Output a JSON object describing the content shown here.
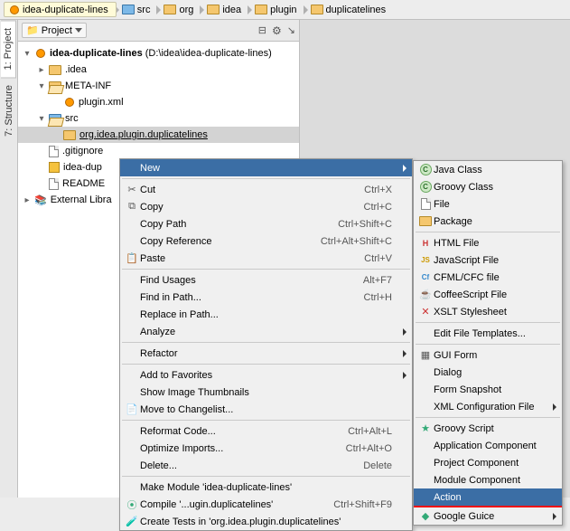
{
  "breadcrumb": [
    "idea-duplicate-lines",
    "src",
    "org",
    "idea",
    "plugin",
    "duplicatelines"
  ],
  "pane": {
    "title": "Project"
  },
  "left_rail": {
    "project": "1: Project",
    "structure": "7: Structure"
  },
  "tree": {
    "root": "idea-duplicate-lines",
    "root_hint": "(D:\\idea\\idea-duplicate-lines)",
    "idea": ".idea",
    "meta": "META-INF",
    "plugin_xml": "plugin.xml",
    "src": "src",
    "pkg": "org.idea.plugin.duplicatelines",
    "gitignore": ".gitignore",
    "iml": "idea-dup",
    "readme": "README",
    "ext": "External Libra"
  },
  "menu1": {
    "new": "New",
    "cut": "Cut",
    "cut_sc": "Ctrl+X",
    "copy": "Copy",
    "copy_sc": "Ctrl+C",
    "copy_path": "Copy Path",
    "copy_path_sc": "Ctrl+Shift+C",
    "copy_ref": "Copy Reference",
    "copy_ref_sc": "Ctrl+Alt+Shift+C",
    "paste": "Paste",
    "paste_sc": "Ctrl+V",
    "find_usages": "Find Usages",
    "find_usages_sc": "Alt+F7",
    "find_in_path": "Find in Path...",
    "find_in_path_sc": "Ctrl+H",
    "replace_in_path": "Replace in Path...",
    "analyze": "Analyze",
    "refactor": "Refactor",
    "add_fav": "Add to Favorites",
    "show_thumbs": "Show Image Thumbnails",
    "move_changelist": "Move to Changelist...",
    "reformat": "Reformat Code...",
    "reformat_sc": "Ctrl+Alt+L",
    "optimize": "Optimize Imports...",
    "optimize_sc": "Ctrl+Alt+O",
    "delete": "Delete...",
    "delete_sc": "Delete",
    "make_module": "Make Module 'idea-duplicate-lines'",
    "compile": "Compile '...ugin.duplicatelines'",
    "compile_sc": "Ctrl+Shift+F9",
    "create_tests": "Create Tests in 'org.idea.plugin.duplicatelines'"
  },
  "menu2": {
    "java_class": "Java Class",
    "groovy_class": "Groovy Class",
    "file": "File",
    "package": "Package",
    "html": "HTML File",
    "js": "JavaScript File",
    "cfml": "CFML/CFC file",
    "coffee": "CoffeeScript File",
    "xslt": "XSLT Stylesheet",
    "edit_tpl": "Edit File Templates...",
    "gui_form": "GUI Form",
    "dialog": "Dialog",
    "form_snap": "Form Snapshot",
    "xml_conf": "XML Configuration File",
    "groovy_script": "Groovy Script",
    "app_comp": "Application Component",
    "proj_comp": "Project Component",
    "mod_comp": "Module Component",
    "action": "Action",
    "guice": "Google Guice"
  }
}
